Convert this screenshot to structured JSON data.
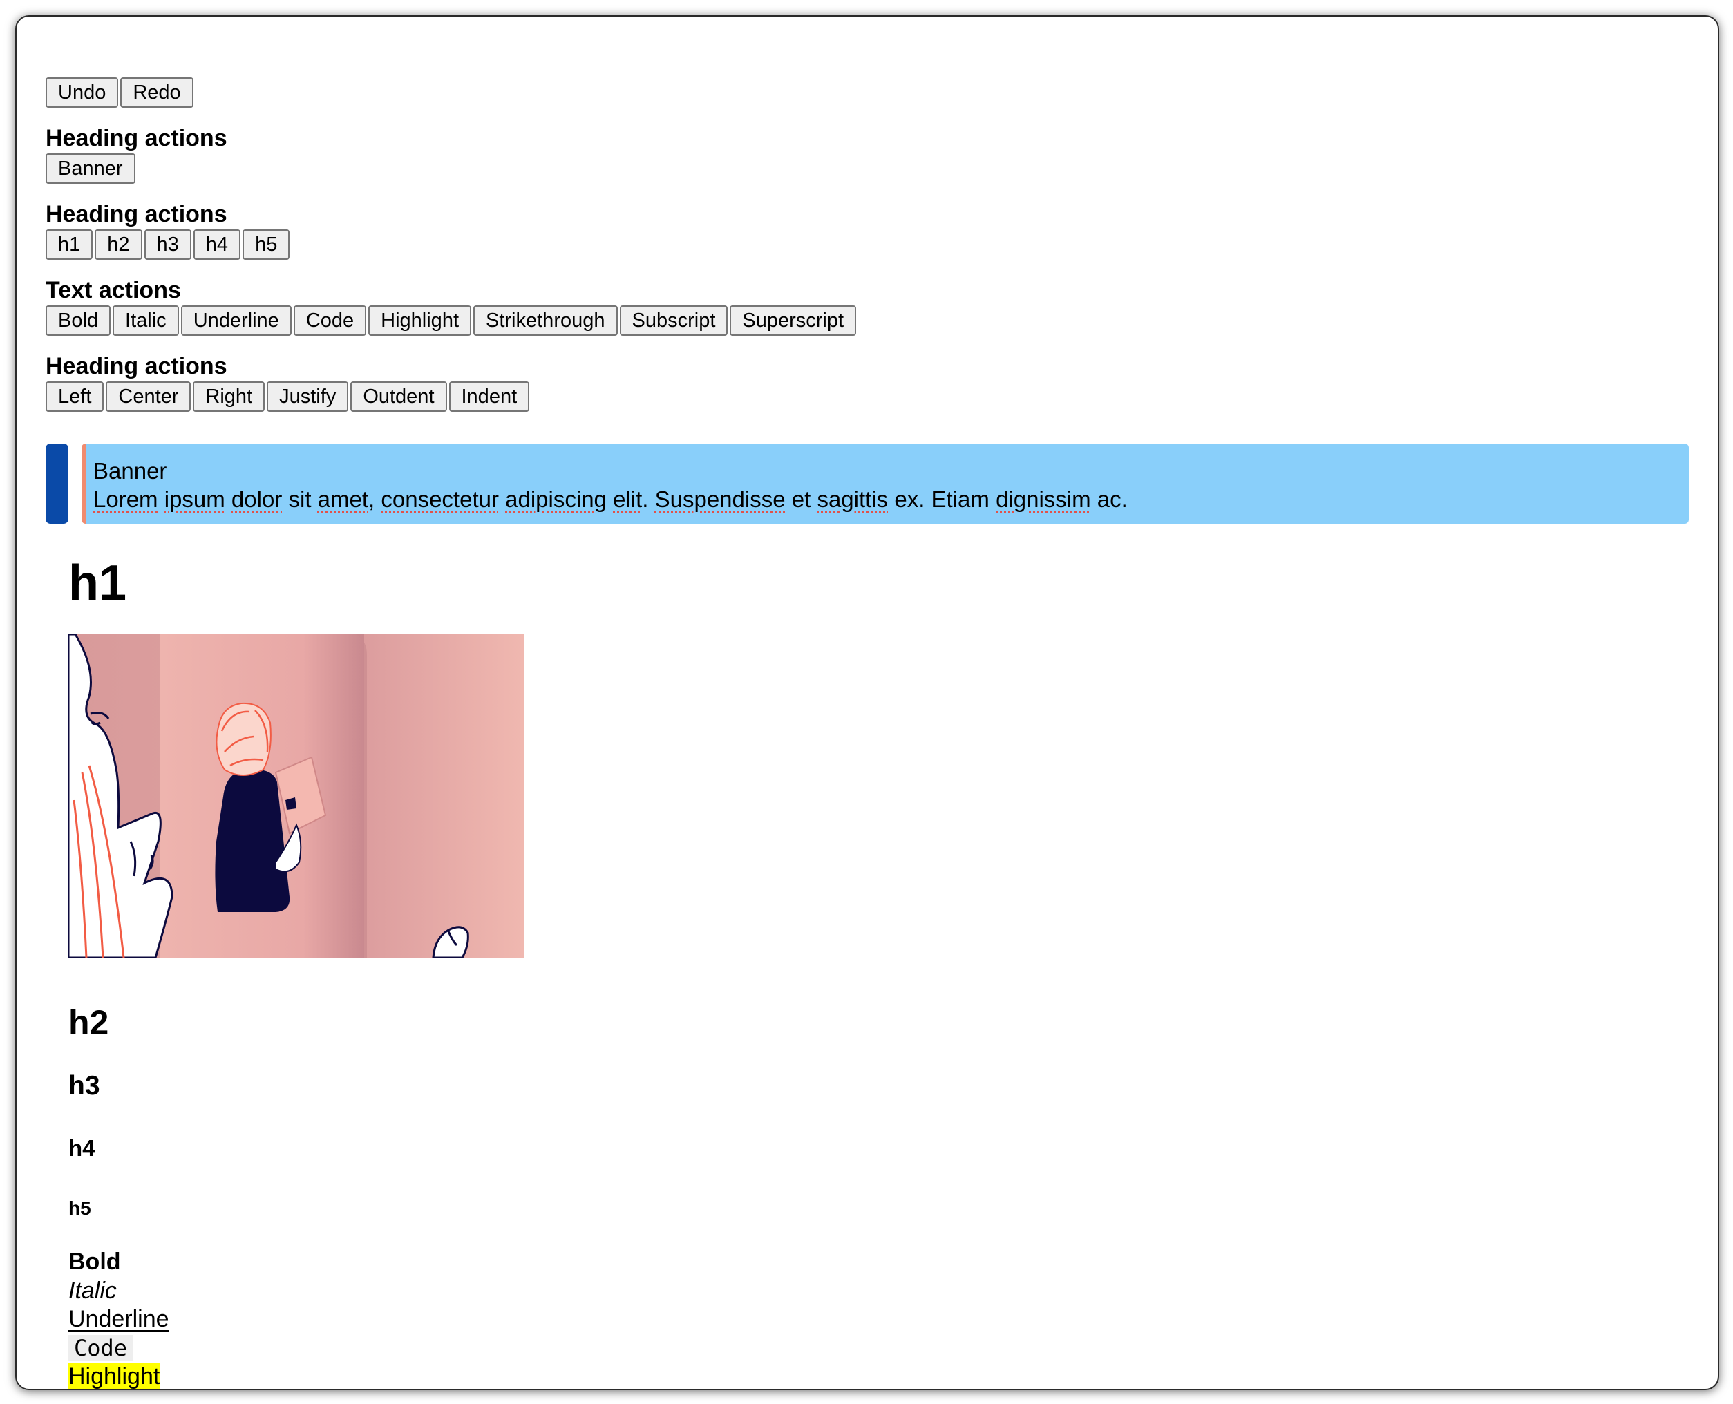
{
  "history_toolbar": {
    "undo": "Undo",
    "redo": "Redo"
  },
  "sections": [
    {
      "title": "Heading actions",
      "buttons": [
        "Banner"
      ]
    },
    {
      "title": "Heading actions",
      "buttons": [
        "h1",
        "h2",
        "h3",
        "h4",
        "h5"
      ]
    },
    {
      "title": "Text actions",
      "buttons": [
        "Bold",
        "Italic",
        "Underline",
        "Code",
        "Highlight",
        "Strikethrough",
        "Subscript",
        "Superscript"
      ]
    },
    {
      "title": "Heading actions",
      "buttons": [
        "Left",
        "Center",
        "Right",
        "Justify",
        "Outdent",
        "Indent"
      ]
    }
  ],
  "banner": {
    "title": "Banner",
    "body_words": [
      "Lorem",
      "ipsum",
      "dolor",
      "sit",
      "amet,",
      "consectetur",
      "adipiscing",
      "elit.",
      "Suspendisse",
      "et",
      "sagittis",
      "ex.",
      "Etiam",
      "dignissim",
      "ac."
    ],
    "misspelled": [
      true,
      true,
      true,
      false,
      true,
      true,
      true,
      true,
      true,
      false,
      true,
      false,
      false,
      true,
      false
    ]
  },
  "editor": {
    "h1": "h1",
    "h2": "h2",
    "h3": "h3",
    "h4": "h4",
    "h5": "h5",
    "marks": {
      "bold": "Bold",
      "italic": "Italic",
      "underline": "Underline",
      "code": "Code",
      "highlight": "Highlight"
    }
  },
  "colors": {
    "banner_handle": "#0a4aa8",
    "banner_bg": "#89cffa",
    "banner_border": "#f08b6f",
    "illustration_bg": "#e8a8a6",
    "ink": "#0c0a3e",
    "hair": "#f25c45",
    "highlight": "#ffff00"
  }
}
